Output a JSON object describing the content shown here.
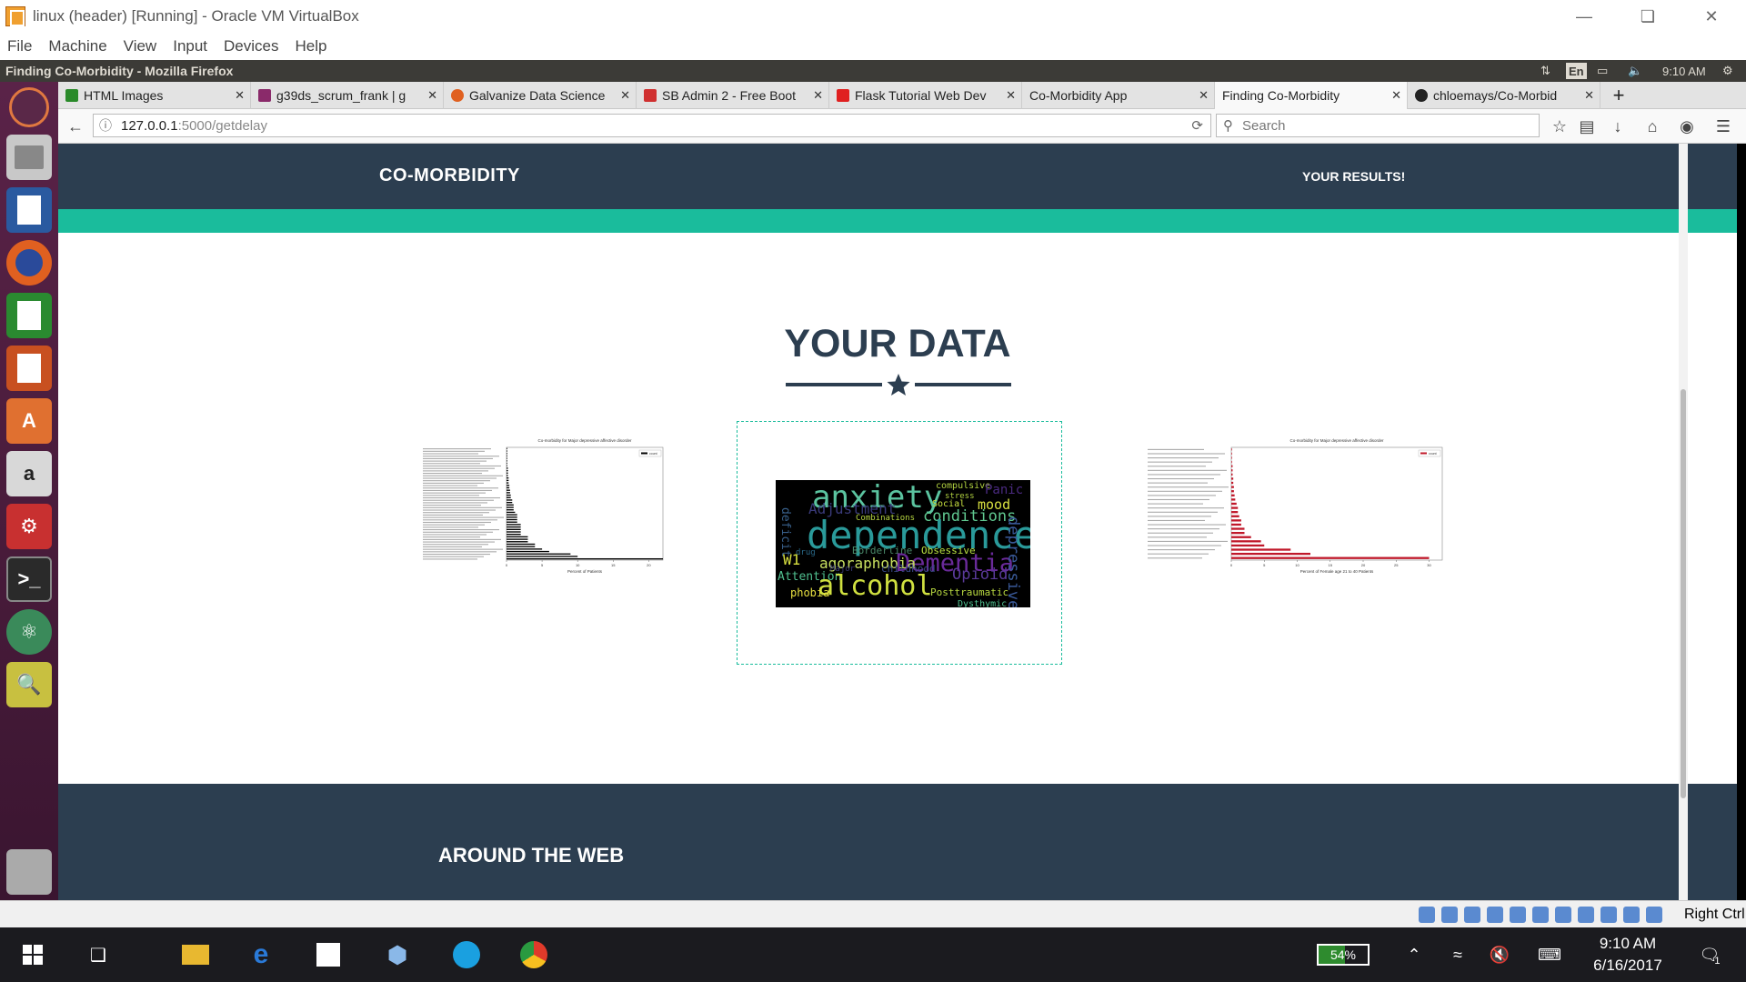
{
  "vb": {
    "title": "linux (header) [Running] - Oracle VM VirtualBox",
    "menu": [
      "File",
      "Machine",
      "View",
      "Input",
      "Devices",
      "Help"
    ],
    "right_ctrl": "Right Ctrl"
  },
  "ubuntu": {
    "window_title": "Finding Co-Morbidity - Mozilla Firefox",
    "lang": "En",
    "time": "9:10 AM"
  },
  "tabs": [
    {
      "label": "HTML Images",
      "color": "#2a8a2a"
    },
    {
      "label": "g39ds_scrum_frank | g",
      "color": "#8a2a6a"
    },
    {
      "label": "Galvanize Data Science",
      "color": "#e06020"
    },
    {
      "label": "SB Admin 2 - Free Boot",
      "color": "#d03030"
    },
    {
      "label": "Flask Tutorial Web Dev",
      "color": "#e02020"
    },
    {
      "label": "Co-Morbidity App",
      "color": ""
    },
    {
      "label": "Finding Co-Morbidity",
      "color": ""
    },
    {
      "label": "chloemays/Co-Morbid",
      "color": "#222"
    }
  ],
  "url": {
    "host": "127.0.0.1",
    "path": ":5000/getdelay"
  },
  "search_placeholder": "Search",
  "site": {
    "brand": "CO-MORBIDITY",
    "nav_link": "YOUR RESULTS!",
    "heading": "YOUR DATA",
    "footer_heading": "AROUND THE WEB"
  },
  "chart1": {
    "title": "Co-morbidity for Major depressive affective disorder",
    "xlabel": "Percent of Patients",
    "legend": "count",
    "color": "#000000",
    "values": [
      22,
      10,
      9,
      6,
      5,
      4,
      4,
      3,
      3,
      3,
      2,
      2,
      2,
      2,
      2,
      1.5,
      1.5,
      1.5,
      1.5,
      1.2,
      1,
      1,
      1,
      0.8,
      0.8,
      0.6,
      0.6,
      0.5,
      0.5,
      0.4,
      0.4,
      0.3,
      0.3,
      0.3,
      0.2,
      0.2,
      0.2,
      0.2,
      0.1,
      0.1,
      0.1,
      0.1,
      0.1,
      0.1,
      0.1,
      0.1
    ],
    "xticks": [
      "0",
      "5",
      "10",
      "15",
      "20"
    ]
  },
  "chart3": {
    "title": "Co-morbidity for Major depressive affective disorder",
    "xlabel": "Percent of Female age 21 to 40 Patients",
    "legend": "count",
    "color": "#c0182a",
    "values": [
      30,
      12,
      9,
      5,
      4.5,
      3,
      2,
      2,
      1.5,
      1.5,
      1.2,
      1,
      1,
      0.8,
      0.6,
      0.5,
      0.4,
      0.4,
      0.3,
      0.3,
      0.2,
      0.2,
      0.2,
      0.1,
      0.1,
      0.1,
      0.1
    ],
    "xticks": [
      "0",
      "5",
      "10",
      "15",
      "20",
      "25",
      "30"
    ]
  },
  "wordcloud": {
    "words": [
      {
        "t": "anxiety",
        "c": "#5bc4a0"
      },
      {
        "t": "compulsive",
        "c": "#b0d040"
      },
      {
        "t": "Panic",
        "c": "#4a2a80"
      },
      {
        "t": "Adjustment",
        "c": "#3a3a7a"
      },
      {
        "t": "stress",
        "c": "#b0d040"
      },
      {
        "t": "Social",
        "c": "#c8e040"
      },
      {
        "t": "mood",
        "c": "#d8e040"
      },
      {
        "t": "conditions",
        "c": "#60c890"
      },
      {
        "t": "Combinations",
        "c": "#b8d840"
      },
      {
        "t": "dependence",
        "c": "#2a9a9a"
      },
      {
        "t": "deficit",
        "c": "#38608a"
      },
      {
        "t": "Borderline",
        "c": "#4a8a6a"
      },
      {
        "t": "Obsessive",
        "c": "#b8e040"
      },
      {
        "t": "Dementia",
        "c": "#6a2a9a"
      },
      {
        "t": "W1",
        "c": "#d8e040"
      },
      {
        "t": "agoraphobia",
        "c": "#c8e060"
      },
      {
        "t": "drug",
        "c": "#2a6a8a"
      },
      {
        "t": "childhood",
        "c": "#3a4a8a"
      },
      {
        "t": "Opioid",
        "c": "#5a3a9a"
      },
      {
        "t": "depressive",
        "c": "#3a5a9a"
      },
      {
        "t": "Attention",
        "c": "#50c090"
      },
      {
        "t": "alcohol",
        "c": "#d0e040"
      },
      {
        "t": "phobia",
        "c": "#e8e040"
      },
      {
        "t": "Posttraumatic",
        "c": "#b8d840"
      },
      {
        "t": "Dysthymic",
        "c": "#50c090"
      },
      {
        "t": "Major",
        "c": "#3a3a7a"
      }
    ]
  },
  "taskbar": {
    "battery": "54%",
    "time": "9:10 AM",
    "date": "6/16/2017",
    "notif": "1"
  }
}
